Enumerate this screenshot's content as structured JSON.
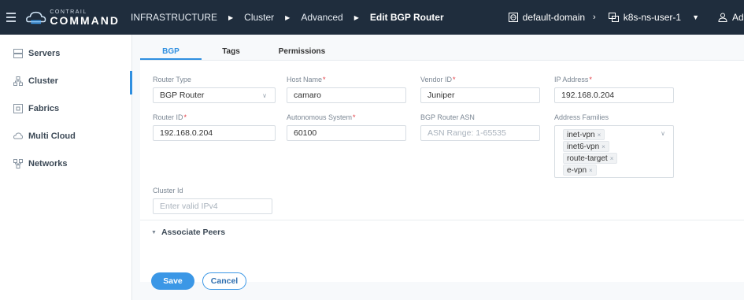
{
  "header": {
    "logo_small": "CONTRAIL",
    "logo_big": "COMMAND",
    "breadcrumbs": [
      "INFRASTRUCTURE",
      "Cluster",
      "Advanced",
      "Edit BGP Router"
    ],
    "domain": "default-domain",
    "project": "k8s-ns-user-1",
    "user": "Admin"
  },
  "sidebar": {
    "items": [
      {
        "label": "Servers",
        "icon": "server-icon"
      },
      {
        "label": "Cluster",
        "icon": "cluster-icon"
      },
      {
        "label": "Fabrics",
        "icon": "fabric-icon"
      },
      {
        "label": "Multi Cloud",
        "icon": "cloud-icon"
      },
      {
        "label": "Networks",
        "icon": "network-icon"
      }
    ],
    "active_index": 1
  },
  "tabs": [
    {
      "label": "BGP",
      "active": true
    },
    {
      "label": "Tags",
      "active": false
    },
    {
      "label": "Permissions",
      "active": false
    }
  ],
  "form": {
    "router_type": {
      "label": "Router Type",
      "value": "BGP Router"
    },
    "host_name": {
      "label": "Host Name",
      "value": "camaro",
      "required": true
    },
    "vendor_id": {
      "label": "Vendor ID",
      "value": "Juniper",
      "required": true
    },
    "ip_address": {
      "label": "IP Address",
      "value": "192.168.0.204",
      "required": true
    },
    "router_id": {
      "label": "Router ID",
      "value": "192.168.0.204",
      "required": true
    },
    "autonomous_system": {
      "label": "Autonomous System",
      "value": "60100",
      "required": true
    },
    "bgp_router_asn": {
      "label": "BGP Router ASN",
      "placeholder": "ASN Range: 1-65535"
    },
    "address_families": {
      "label": "Address Families",
      "values": [
        "inet-vpn",
        "inet6-vpn",
        "route-target",
        "e-vpn"
      ]
    },
    "cluster_id": {
      "label": "Cluster Id",
      "placeholder": "Enter valid IPv4"
    },
    "associate_peers": "Associate Peers"
  },
  "actions": {
    "save": "Save",
    "cancel": "Cancel"
  },
  "colors": {
    "topbar": "#1f2d3d",
    "accent": "#2f8fe0",
    "required": "#e2383f"
  }
}
